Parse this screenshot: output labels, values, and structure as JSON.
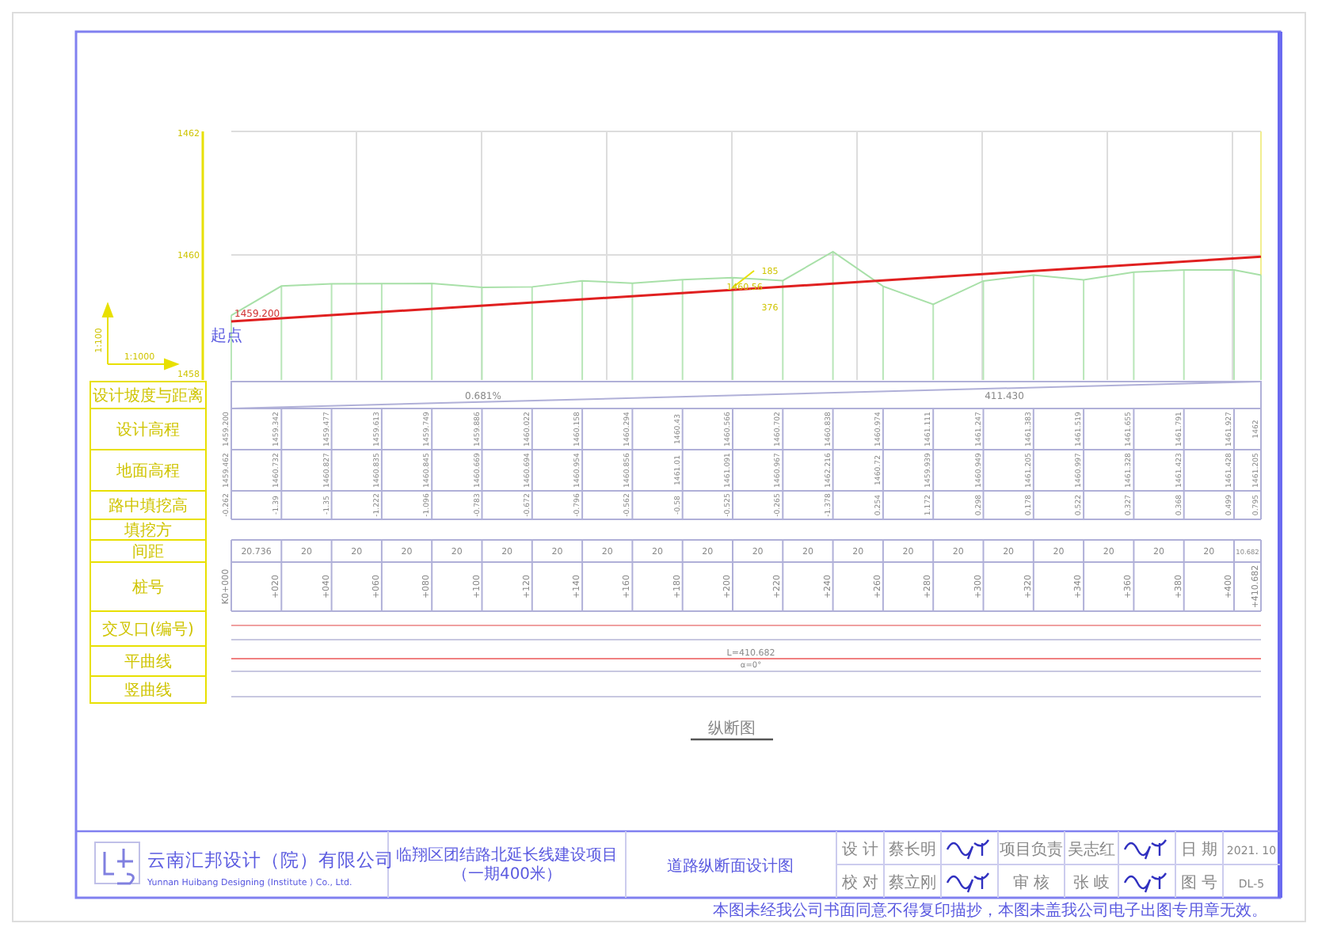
{
  "axis": {
    "labels": [
      "1462",
      "1460",
      "1458"
    ],
    "scale_vertical": "1:100",
    "scale_horizontal": "1:1000"
  },
  "profile": {
    "start_elevation": "1459.200",
    "start_point": "起点",
    "annotations": [
      "1460.56",
      "185",
      "376"
    ]
  },
  "row_labels": [
    "设计坡度与距离",
    "设计高程",
    "地面高程",
    "路中填挖高",
    "填挖方",
    "间距",
    "桩号",
    "交叉口(编号)",
    "平曲线",
    "竖曲线"
  ],
  "grade": {
    "slope": "0.681%",
    "length": "411.430"
  },
  "stations": [
    {
      "station": "K0+000",
      "design": "1459.200",
      "ground": "1459.462",
      "fill": "-0.262"
    },
    {
      "station": "+020",
      "design": "1459.342",
      "ground": "1460.732",
      "fill": "-1.39"
    },
    {
      "station": "+040",
      "design": "1459.477",
      "ground": "1460.827",
      "fill": "-1.35"
    },
    {
      "station": "+060",
      "design": "1459.613",
      "ground": "1460.835",
      "fill": "-1.222"
    },
    {
      "station": "+080",
      "design": "1459.749",
      "ground": "1460.845",
      "fill": "-1.096"
    },
    {
      "station": "+100",
      "design": "1459.886",
      "ground": "1460.669",
      "fill": "-0.783"
    },
    {
      "station": "+120",
      "design": "1460.022",
      "ground": "1460.694",
      "fill": "-0.672"
    },
    {
      "station": "+140",
      "design": "1460.158",
      "ground": "1460.954",
      "fill": "-0.796"
    },
    {
      "station": "+160",
      "design": "1460.294",
      "ground": "1460.856",
      "fill": "-0.562"
    },
    {
      "station": "+180",
      "design": "1460.43",
      "ground": "1461.01",
      "fill": "-0.58"
    },
    {
      "station": "+200",
      "design": "1460.566",
      "ground": "1461.091",
      "fill": "-0.525"
    },
    {
      "station": "+220",
      "design": "1460.702",
      "ground": "1460.967",
      "fill": "-0.265"
    },
    {
      "station": "+240",
      "design": "1460.838",
      "ground": "1462.216",
      "fill": "-1.378"
    },
    {
      "station": "+260",
      "design": "1460.974",
      "ground": "1460.72",
      "fill": "0.254"
    },
    {
      "station": "+280",
      "design": "1461.111",
      "ground": "1459.939",
      "fill": "1.172"
    },
    {
      "station": "+300",
      "design": "1461.247",
      "ground": "1460.949",
      "fill": "0.298"
    },
    {
      "station": "+320",
      "design": "1461.383",
      "ground": "1461.205",
      "fill": "0.178"
    },
    {
      "station": "+340",
      "design": "1461.519",
      "ground": "1460.997",
      "fill": "0.522"
    },
    {
      "station": "+360",
      "design": "1461.655",
      "ground": "1461.328",
      "fill": "0.327"
    },
    {
      "station": "+380",
      "design": "1461.791",
      "ground": "1461.423",
      "fill": "0.368"
    },
    {
      "station": "+400",
      "design": "1461.927",
      "ground": "1461.428",
      "fill": "0.499"
    },
    {
      "station": "+410.682",
      "design": "1462",
      "ground": "1461.205",
      "fill": "0.795"
    }
  ],
  "distances": [
    "20.736",
    "20",
    "20",
    "20",
    "20",
    "20",
    "20",
    "20",
    "20",
    "20",
    "20",
    "20",
    "20",
    "20",
    "20",
    "20",
    "20",
    "20",
    "20",
    "20",
    "10.682"
  ],
  "curves": {
    "horizontal": "L=410.682",
    "angle": "α=0°"
  },
  "caption": "纵断图",
  "title_block": {
    "company": "云南汇邦设计（院）有限公司",
    "company_en": "Yunnan Huibang Designing (Institute ) Co., Ltd.",
    "project": [
      "临翔区团结路北延长线建设项目",
      "（一期400米）"
    ],
    "drawing_title": "道路纵断面设计图",
    "rows": [
      [
        {
          "kind": "label",
          "text": "设 计"
        },
        {
          "kind": "name",
          "text": "蔡长明"
        },
        {
          "kind": "signature"
        },
        {
          "kind": "label",
          "text": "项目负责"
        },
        {
          "kind": "name",
          "text": "吴志红"
        },
        {
          "kind": "signature"
        },
        {
          "kind": "label",
          "text": "日 期"
        },
        {
          "kind": "value",
          "text": "2021. 10"
        }
      ],
      [
        {
          "kind": "label",
          "text": "校 对"
        },
        {
          "kind": "name",
          "text": "蔡立刚"
        },
        {
          "kind": "signature"
        },
        {
          "kind": "label",
          "text": "审 核"
        },
        {
          "kind": "name",
          "text": "张 岐"
        },
        {
          "kind": "signature"
        },
        {
          "kind": "label",
          "text": "图 号"
        },
        {
          "kind": "value",
          "text": "DL-5"
        }
      ]
    ]
  },
  "note": "本图未经我公司书面同意不得复印描抄，本图未盖我公司电子出图专用章无效。"
}
